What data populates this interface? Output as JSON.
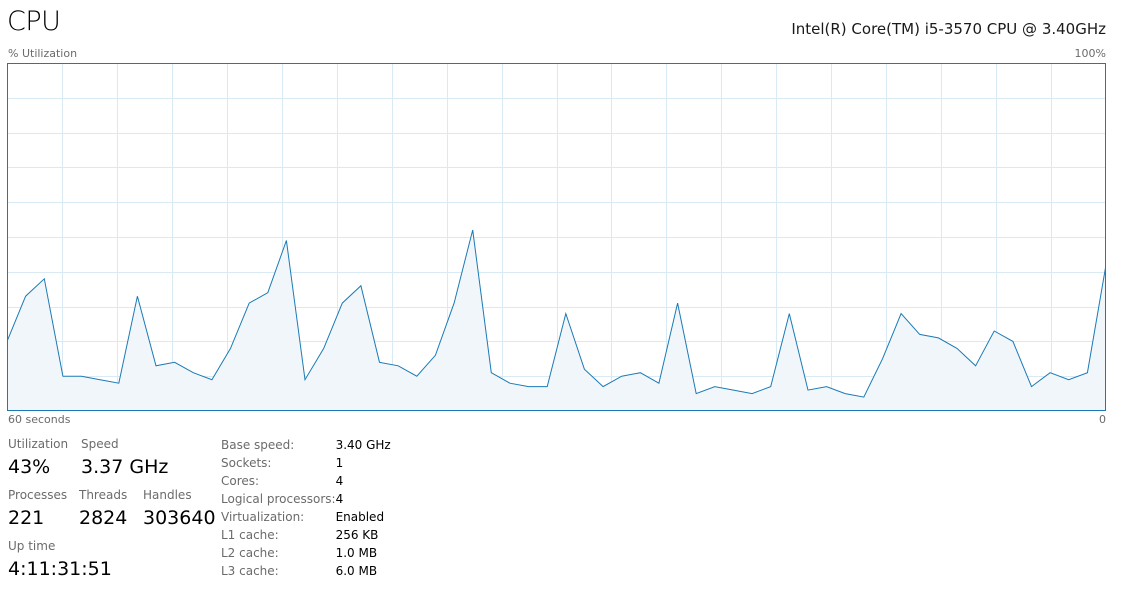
{
  "header": {
    "title": "CPU",
    "cpu_model": "Intel(R) Core(TM) i5-3570 CPU @ 3.40GHz"
  },
  "graph": {
    "y_label": "% Utilization",
    "y_max_label": "100%",
    "x_left_label": "60 seconds",
    "x_right_label": "0",
    "line_color": "#1b7ab5",
    "fill_color": "#f1f6fb",
    "grid_color": "#d9eaf4",
    "border_color": "#1b7ab5",
    "utilization_percent": [
      20,
      33,
      38,
      10,
      10,
      9,
      8,
      33,
      13,
      14,
      11,
      9,
      18,
      31,
      34,
      49,
      9,
      18,
      31,
      36,
      14,
      13,
      10,
      16,
      31,
      52,
      11,
      8,
      7,
      7,
      28,
      12,
      7,
      10,
      11,
      8,
      31,
      5,
      7,
      6,
      5,
      7,
      28,
      6,
      7,
      5,
      4,
      15,
      28,
      22,
      21,
      18,
      13,
      23,
      20,
      7,
      11,
      9,
      11,
      42
    ]
  },
  "stats": {
    "utilization": {
      "label": "Utilization",
      "value": "43%"
    },
    "speed": {
      "label": "Speed",
      "value": "3.37 GHz"
    },
    "processes": {
      "label": "Processes",
      "value": "221"
    },
    "threads": {
      "label": "Threads",
      "value": "2824"
    },
    "handles": {
      "label": "Handles",
      "value": "303640"
    },
    "uptime": {
      "label": "Up time",
      "value": "4:11:31:51"
    }
  },
  "details": [
    {
      "key": "Base speed:",
      "value": "3.40 GHz"
    },
    {
      "key": "Sockets:",
      "value": "1"
    },
    {
      "key": "Cores:",
      "value": "4"
    },
    {
      "key": "Logical processors:",
      "value": "4"
    },
    {
      "key": "Virtualization:",
      "value": "Enabled"
    },
    {
      "key": "L1 cache:",
      "value": "256 KB"
    },
    {
      "key": "L2 cache:",
      "value": "1.0 MB"
    },
    {
      "key": "L3 cache:",
      "value": "6.0 MB"
    }
  ]
}
